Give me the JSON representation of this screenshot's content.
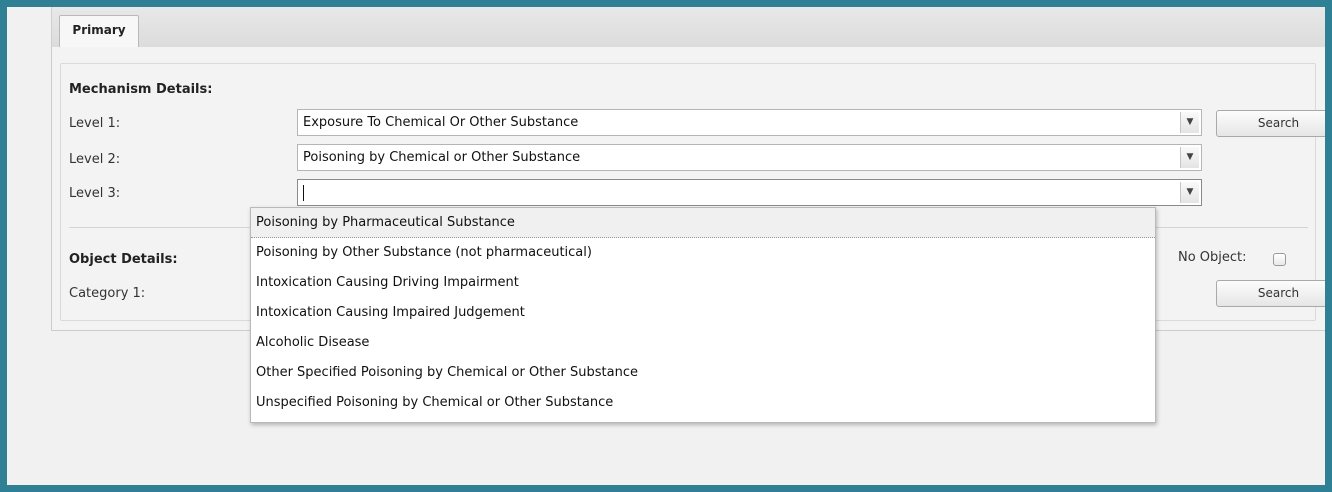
{
  "tabs": [
    {
      "label": "Primary",
      "active": true
    }
  ],
  "mechanism": {
    "title": "Mechanism Details:",
    "levels": [
      {
        "label": "Level 1:",
        "value": "Exposure To Chemical Or Other Substance"
      },
      {
        "label": "Level 2:",
        "value": "Poisoning by Chemical or Other Substance"
      },
      {
        "label": "Level 3:",
        "value": ""
      }
    ],
    "search_label": "Search"
  },
  "object": {
    "title": "Object Details:",
    "category_label": "Category 1:",
    "no_object_label": "No Object:",
    "no_object_checked": false,
    "search_label": "Search"
  },
  "dropdown": {
    "highlighted_index": 0,
    "options": [
      "Poisoning by Pharmaceutical Substance",
      "Poisoning by Other Substance (not pharmaceutical)",
      "Intoxication Causing Driving Impairment",
      "Intoxication Causing Impaired Judgement",
      "Alcoholic Disease",
      "Other Specified Poisoning by Chemical or Other Substance",
      "Unspecified Poisoning by Chemical or Other Substance"
    ]
  },
  "icons": {
    "combo_arrow": "chevron-down-icon",
    "checkbox": "checkbox-icon"
  },
  "colors": {
    "frame_border": "#2f7f95",
    "panel_background": "#f3f3f3"
  }
}
